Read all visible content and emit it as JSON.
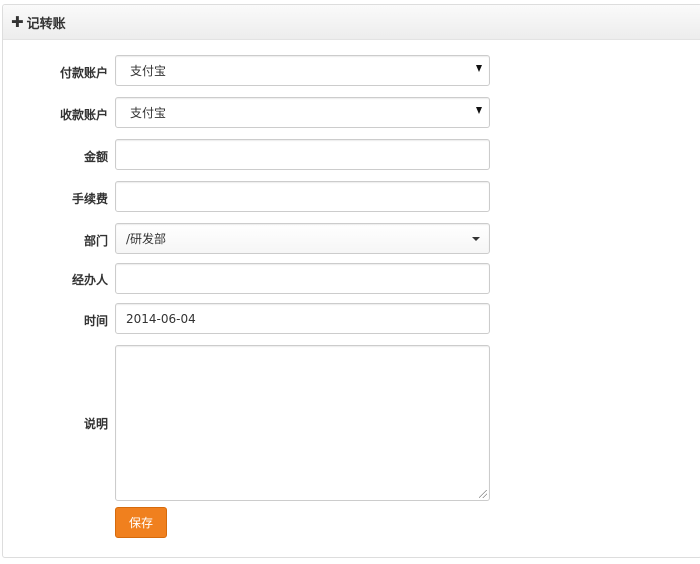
{
  "panel": {
    "title": "记转账"
  },
  "form": {
    "pay_account": {
      "label": "付款账户",
      "value": "支付宝"
    },
    "receive_account": {
      "label": "收款账户",
      "value": "支付宝"
    },
    "amount": {
      "label": "金额",
      "value": ""
    },
    "fee": {
      "label": "手续费",
      "value": ""
    },
    "department": {
      "label": "部门",
      "value": "/研发部"
    },
    "handler": {
      "label": "经办人",
      "value": ""
    },
    "time": {
      "label": "时间",
      "value": "2014-06-04"
    },
    "note": {
      "label": "说明",
      "value": ""
    }
  },
  "save_label": "保存",
  "colors": {
    "save_button": "#f0801e",
    "border": "#cccccc",
    "heading_bg": "#f5f5f5"
  }
}
